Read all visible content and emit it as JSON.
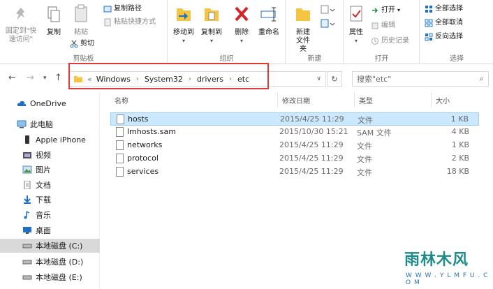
{
  "ribbon": {
    "clipboard": {
      "pin_label": "固定到\"快速访问\"",
      "copy_label": "复制",
      "paste_label": "粘贴",
      "copy_path_label": "复制路径",
      "paste_shortcut_label": "粘贴快捷方式",
      "cut_label": "剪切",
      "group_label": "剪贴板"
    },
    "organize": {
      "move_to_label": "移动到",
      "copy_to_label": "复制到",
      "delete_label": "删除",
      "rename_label": "重命名",
      "group_label": "组织"
    },
    "new": {
      "new_folder_label": "新建文件夹",
      "group_label": "新建"
    },
    "open": {
      "properties_label": "属性",
      "open_label": "打开",
      "edit_label": "编辑",
      "history_label": "历史记录",
      "group_label": "打开"
    },
    "select": {
      "select_all_label": "全部选择",
      "select_none_label": "全部取消",
      "invert_label": "反向选择",
      "group_label": "选择"
    }
  },
  "address": {
    "prefix": "«",
    "crumbs": [
      "Windows",
      "System32",
      "drivers",
      "etc"
    ],
    "search_placeholder": "搜索\"etc\""
  },
  "nav": {
    "items": [
      {
        "label": "OneDrive"
      },
      {
        "label": "此电脑"
      },
      {
        "label": "Apple iPhone"
      },
      {
        "label": "视频"
      },
      {
        "label": "图片"
      },
      {
        "label": "文档"
      },
      {
        "label": "下载"
      },
      {
        "label": "音乐"
      },
      {
        "label": "桌面"
      },
      {
        "label": "本地磁盘 (C:)"
      },
      {
        "label": "本地磁盘 (D:)"
      },
      {
        "label": "本地磁盘 (E:)"
      }
    ]
  },
  "list": {
    "columns": {
      "name": "名称",
      "date": "修改日期",
      "type": "类型",
      "size": "大小"
    },
    "rows": [
      {
        "name": "hosts",
        "date": "2015/4/25 11:29",
        "type": "文件",
        "size": "1 KB"
      },
      {
        "name": "lmhosts.sam",
        "date": "2015/10/30 15:21",
        "type": "SAM 文件",
        "size": "4 KB"
      },
      {
        "name": "networks",
        "date": "2015/4/25 11:29",
        "type": "文件",
        "size": "1 KB"
      },
      {
        "name": "protocol",
        "date": "2015/4/25 11:29",
        "type": "文件",
        "size": "2 KB"
      },
      {
        "name": "services",
        "date": "2015/4/25 11:29",
        "type": "文件",
        "size": "18 KB"
      }
    ]
  },
  "watermark": {
    "title": "雨林木风",
    "url": "W W W . Y L M F U . C O M"
  },
  "colors": {
    "highlight": "#e03a3a",
    "selection": "#cce8ff",
    "accent": "#1e6fc8"
  }
}
